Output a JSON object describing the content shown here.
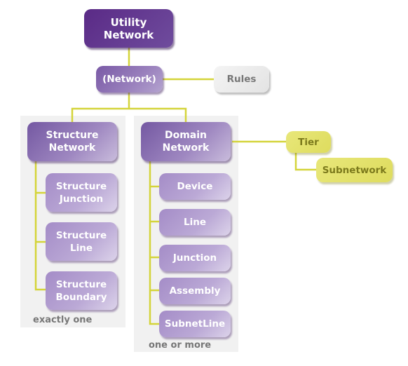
{
  "diagram": {
    "root": {
      "label": "Utility Network"
    },
    "network": {
      "label": "(Network)"
    },
    "rules": {
      "label": "Rules"
    },
    "structure_network": {
      "label": "Structure\nNetwork",
      "children": [
        "Structure\nJunction",
        "Structure\nLine",
        "Structure\nBoundary"
      ],
      "cardinality": "exactly one"
    },
    "domain_network": {
      "label": "Domain\nNetwork",
      "children": [
        "Device",
        "Line",
        "Junction",
        "Assembly",
        "SubnetLine"
      ],
      "cardinality": "one or more"
    },
    "tier": {
      "label": "Tier"
    },
    "subnetwork": {
      "label": "Subnetwork"
    }
  },
  "colors": {
    "connector": "#d4d43a",
    "root": "#5a2a86",
    "node": "#8a6cb3",
    "panel": "#f1f1f1",
    "tier": "#e4e36c"
  }
}
